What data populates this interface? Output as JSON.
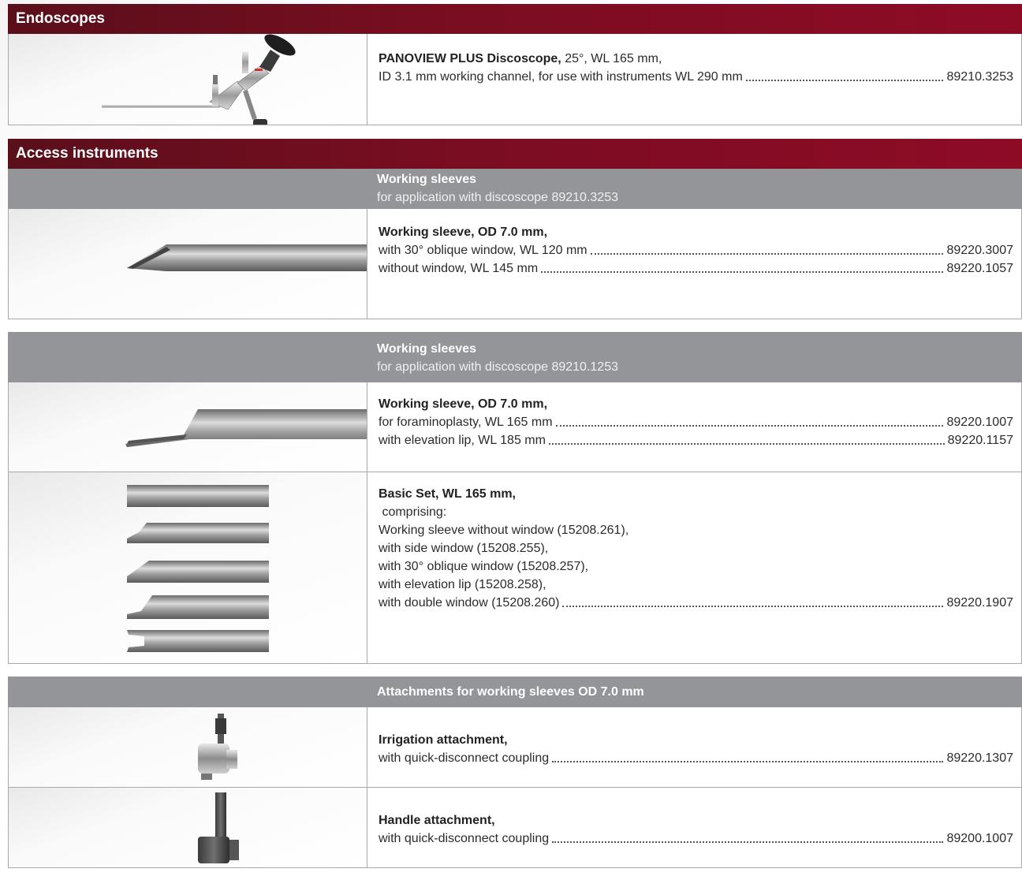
{
  "endoscopes": {
    "header": "Endoscopes",
    "item": {
      "title_bold": "PANOVIEW PLUS Discoscope,",
      "title_rest": " 25°, WL 165 mm,",
      "line2_text": "ID 3.1 mm working channel, for use with instruments WL 290 mm",
      "line2_code": "89210.3253"
    }
  },
  "access": {
    "header": "Access instruments",
    "group1": {
      "title": "Working sleeves",
      "subtitle": "for application with discoscope 89210.3253",
      "item": {
        "title": "Working sleeve, OD 7.0 mm,",
        "lines": [
          {
            "text": "with 30° oblique window, WL 120 mm",
            "code": "89220.3007"
          },
          {
            "text": "without window, WL 145 mm",
            "code": "89220.1057"
          }
        ]
      }
    },
    "group2": {
      "title": "Working sleeves",
      "subtitle": "for application with discoscope 89210.1253",
      "item1": {
        "title": "Working sleeve, OD 7.0 mm,",
        "lines": [
          {
            "text": "for foraminoplasty, WL 165 mm",
            "code": "89220.1007"
          },
          {
            "text": "with elevation lip, WL 185 mm",
            "code": "89220.1157"
          }
        ]
      },
      "item2": {
        "title": "Basic Set, WL 165 mm,",
        "plain_lines": [
          " comprising:",
          "Working sleeve without window (15208.261),",
          "with side window (15208.255),",
          "with 30° oblique window (15208.257),",
          "with elevation lip (15208.258),"
        ],
        "last_line": {
          "text": "with double window (15208.260)",
          "code": "89220.1907"
        }
      }
    },
    "group3": {
      "title": "Attachments for working sleeves OD 7.0 mm",
      "item1": {
        "title": "Irrigation attachment,",
        "line": {
          "text": "with quick-disconnect coupling",
          "code": "89220.1307"
        }
      },
      "item2": {
        "title": "Handle attachment,",
        "line": {
          "text": "with quick-disconnect coupling",
          "code": "89200.1007"
        }
      }
    }
  },
  "colors": {
    "header_red": "#7a0d22",
    "grey_band": "#939598",
    "border": "#a7a9ac"
  }
}
